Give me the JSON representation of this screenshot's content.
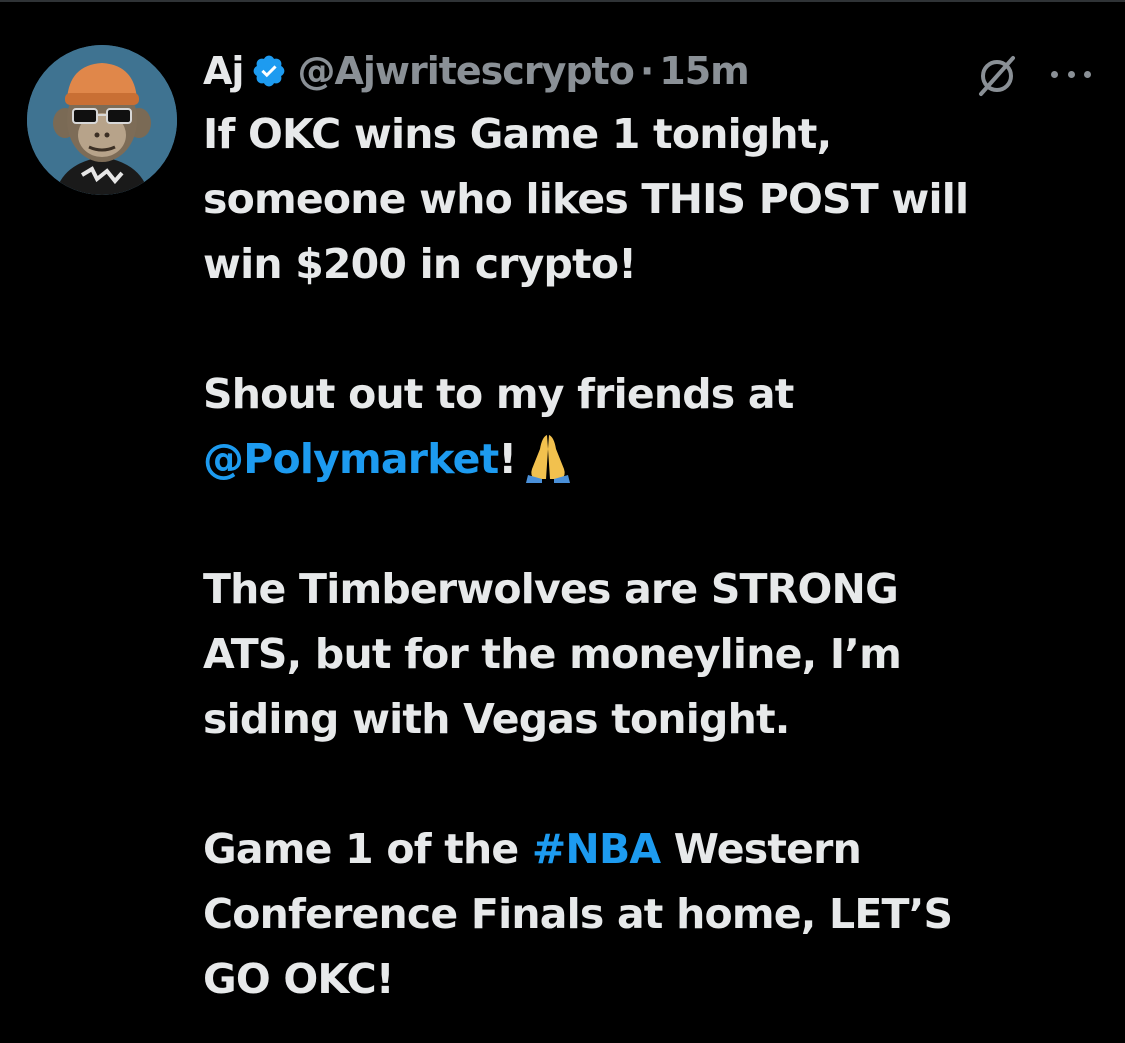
{
  "tweet": {
    "display_name": "Aj",
    "handle": "@Ajwritescrypto",
    "separator": "·",
    "timestamp": "15m",
    "icons": {
      "verified": "verified-badge-icon",
      "grok": "grok-icon",
      "more": "more-icon"
    },
    "colors": {
      "background": "#000000",
      "text": "#e7e9ea",
      "secondary": "#8a9096",
      "accent": "#1d9bf0"
    },
    "lines": [
      "If OKC wins Game 1 tonight,",
      "someone who likes THIS POST will",
      "win $200 in crypto!",
      "",
      "Shout out to my friends at",
      "",
      "",
      "The Timberwolves are STRONG",
      "ATS, but for the moneyline, I’m",
      "siding with Vegas tonight.",
      "",
      "",
      "Conference Finals at home, LET’S",
      "GO OKC!"
    ],
    "mention": "@Polymarket",
    "mention_suffix": "!",
    "emoji": "🙏",
    "game_line_prefix": "Game 1 of the ",
    "hashtag": "#NBA",
    "game_line_suffix": " Western"
  }
}
